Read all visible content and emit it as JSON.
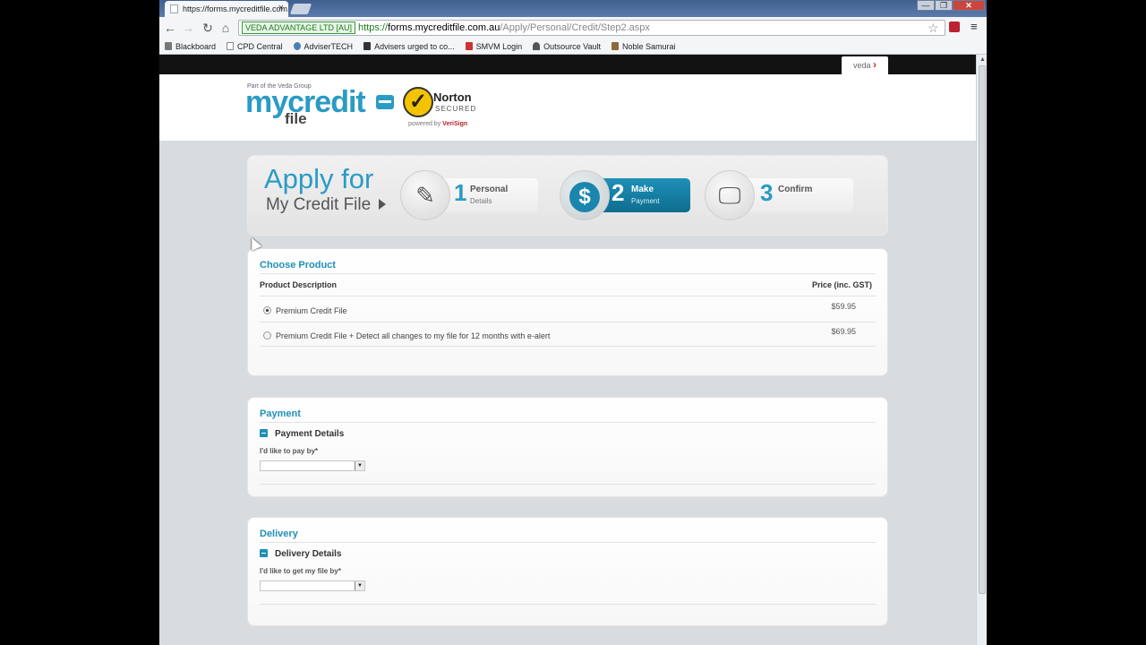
{
  "browser": {
    "tab_title": "https://forms.mycreditfile.com.au",
    "ev_badge": "VEDA ADVANTAGE LTD [AU]",
    "url_scheme": "https://",
    "url_host": "forms.mycreditfile.com.au",
    "url_path": "/Apply/Personal/Credit/Step2.aspx",
    "window_buttons": [
      "—",
      "❐",
      "✕"
    ],
    "bookmarks": [
      {
        "label": "Blackboard",
        "icon": "blackboard-icon"
      },
      {
        "label": "CPD Central",
        "icon": "page-icon"
      },
      {
        "label": "AdviserTECH",
        "icon": "snowflake-icon"
      },
      {
        "label": "Advisers urged to co...",
        "icon": "chart-icon"
      },
      {
        "label": "SMVM Login",
        "icon": "login-icon"
      },
      {
        "label": "Outsource Vault",
        "icon": "vault-icon"
      },
      {
        "label": "Noble Samurai",
        "icon": "samurai-icon"
      }
    ]
  },
  "veda_tab": "veda",
  "logo": {
    "tagline": "Part of the Veda Group",
    "main": "mycredit",
    "sub": "file"
  },
  "norton": {
    "name": "Norton",
    "secured": "SECURED",
    "powered_prefix": "powered by",
    "powered_brand": "VeriSign"
  },
  "steps_panel": {
    "title": "Apply for",
    "subtitle": "My Credit File",
    "steps": [
      {
        "num": "1",
        "label": "Personal",
        "sub": "Details",
        "icon": "pencil-icon",
        "active": false
      },
      {
        "num": "2",
        "label": "Make",
        "sub": "Payment",
        "icon": "dollar-icon",
        "active": true
      },
      {
        "num": "3",
        "label": "Confirm",
        "sub": "",
        "icon": "monitor-icon",
        "active": false
      }
    ]
  },
  "choose_product": {
    "title": "Choose Product",
    "col_desc": "Product Description",
    "col_price": "Price (inc. GST)",
    "products": [
      {
        "desc": "Premium Credit File",
        "price": "$59.95",
        "selected": true
      },
      {
        "desc": "Premium Credit File + Detect all changes to my file for 12 months with e-alert",
        "price": "$69.95",
        "selected": false
      }
    ]
  },
  "payment": {
    "title": "Payment",
    "sub_title": "Payment Details",
    "field_label": "I'd like to pay by*",
    "selected_value": ""
  },
  "delivery": {
    "title": "Delivery",
    "sub_title": "Delivery Details",
    "field_label": "I'd like to get my file by*",
    "selected_value": ""
  },
  "colors": {
    "accent": "#2a9bc5",
    "active_step": "#1f90b8",
    "veda_red": "#d8232a"
  }
}
